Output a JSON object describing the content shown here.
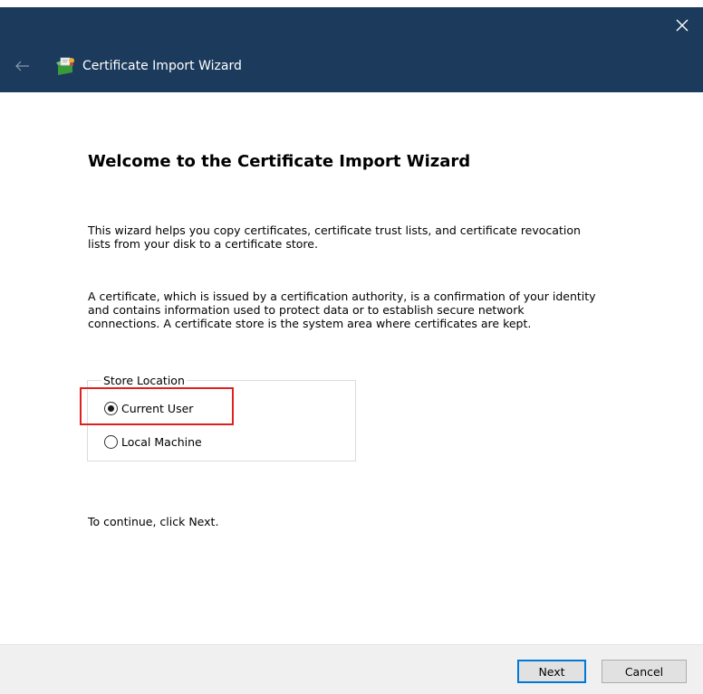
{
  "window": {
    "title": "Certificate Import Wizard",
    "titlebar_color": "#1b3a5c"
  },
  "icons": {
    "close": "close-icon",
    "back": "back-arrow-icon",
    "wizard": "certificate-wizard-icon",
    "radio": "radio-button"
  },
  "content": {
    "heading": "Welcome to the Certificate Import Wizard",
    "paragraph1_line1": "This wizard helps you copy certificates, certificate trust lists, and certificate revocation",
    "paragraph1_line2": "lists from your disk to a certificate store.",
    "paragraph2_line1": "A certificate, which is issued by a certification authority, is a confirmation of your identity",
    "paragraph2_line2": "and contains information used to protect data or to establish secure network",
    "paragraph2_line3": "connections. A certificate store is the system area where certificates are kept.",
    "continue_text": "To continue, click Next."
  },
  "store_location": {
    "legend": "Store Location",
    "options": [
      {
        "label": "Current User",
        "selected": true
      },
      {
        "label": "Local Machine",
        "selected": false
      }
    ],
    "highlight_color": "#e02020"
  },
  "footer": {
    "next_label": "Next",
    "cancel_label": "Cancel",
    "focus_color": "#0078d7"
  }
}
